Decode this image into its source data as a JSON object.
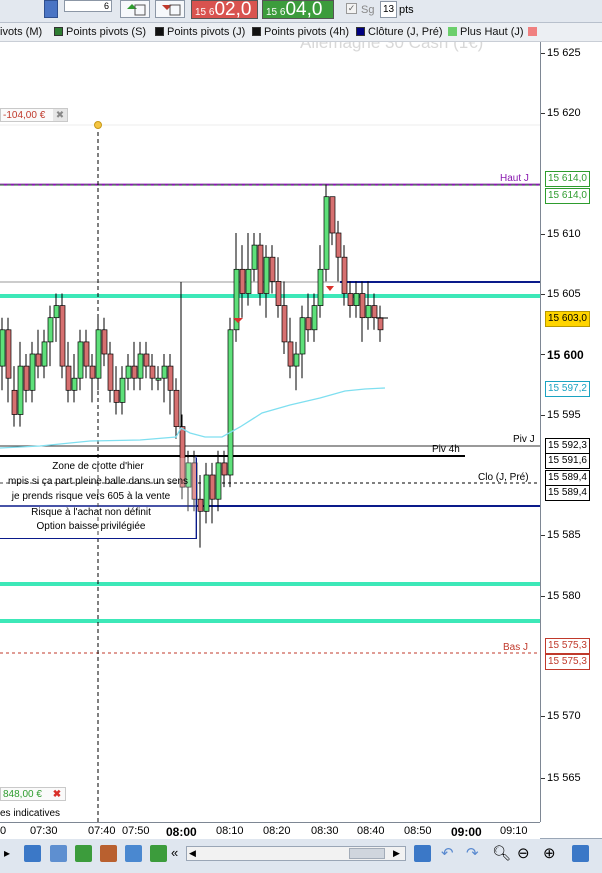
{
  "toolbar": {
    "qty_value": "6",
    "sell_price_small": "15 6",
    "sell_price_big": "02,0",
    "buy_price_small": "15 6",
    "buy_price_big": "04,0",
    "sg_label": "Sg",
    "pts_value": "13",
    "pts_label": "pts"
  },
  "legend": [
    {
      "label": "ivots (M)",
      "color": "#8b4513"
    },
    {
      "label": "Points pivots (S)",
      "color": "#2e7d32"
    },
    {
      "label": "Points pivots (J)",
      "color": "#000000"
    },
    {
      "label": "Points pivots (4h)",
      "color": "#000000"
    },
    {
      "label": "Clôture (J, Pré)",
      "color": "#000080"
    },
    {
      "label": "Plus Haut (J)",
      "color": "#6ccf6c"
    }
  ],
  "watermark": "Allemagne 30 Cash (1€)",
  "orders": {
    "stop_label": "-104,00 €",
    "target_label": "848,00 €"
  },
  "line_labels": {
    "haut_j": "Haut J",
    "piv_j": "Piv J",
    "piv_4h": "Piv 4h",
    "clo": "Clo (J, Pré)",
    "bas_j": "Bas J"
  },
  "note": {
    "lines": [
      "Zone de crotte d'hier",
      "mpis si ça part pleine balle dans un sens",
      "je prends risque vers 605 à la vente",
      "Risque à l'achat non définit",
      "Option baisse privilégiée"
    ]
  },
  "bottom_label": "es indicatives",
  "y_axis": {
    "ticks": [
      "15 625",
      "15 620",
      "15 610",
      "15 605",
      "15 600",
      "15 595",
      "15 585",
      "15 580",
      "15 570",
      "15 565"
    ],
    "price_tags": [
      {
        "text": "15 614,0",
        "color": "#2e9c2e"
      },
      {
        "text": "15 614,0",
        "color": "#2e9c2e"
      },
      {
        "text": "15 603,0",
        "color": "#000000"
      },
      {
        "text": "15 597,2",
        "color": "#1aa3c2"
      },
      {
        "text": "15 592,3",
        "color": "#000000"
      },
      {
        "text": "15 591,6",
        "color": "#000000"
      },
      {
        "text": "15 589,4",
        "color": "#000000"
      },
      {
        "text": "15 589,4",
        "color": "#000000"
      },
      {
        "text": "15 575,3",
        "color": "#c0392b"
      },
      {
        "text": "15 575,3",
        "color": "#c0392b"
      }
    ]
  },
  "x_axis": {
    "ticks": [
      "0",
      "07:30",
      "07:40",
      "07:50",
      "08:00",
      "08:10",
      "08:20",
      "08:30",
      "08:40",
      "08:50",
      "09:00",
      "09:10"
    ],
    "bold": [
      "08:00",
      "09:00"
    ]
  },
  "colors": {
    "pivot_purple": "#8a19b0",
    "turquoise": "#3de8b8",
    "navy": "#0a1a8a",
    "bull": "#5ee07a",
    "bear": "#d67070",
    "ma": "#7fdff0",
    "bas_j": "#c0392b",
    "haut_dash": "#3c9a3c"
  },
  "chart_data": {
    "type": "candlestick",
    "x": [
      "07:30",
      "07:40",
      "07:50",
      "08:00",
      "08:10",
      "08:20",
      "08:30",
      "08:40"
    ],
    "ylim": [
      15561,
      15628
    ],
    "levels": {
      "haut_j": 15614.0,
      "piv_j": 15592.3,
      "piv_4h": 15591.6,
      "clo_j_pre": 15589.4,
      "bas_j": 15575.3,
      "last": 15603.0,
      "ma": 15597.2
    }
  }
}
